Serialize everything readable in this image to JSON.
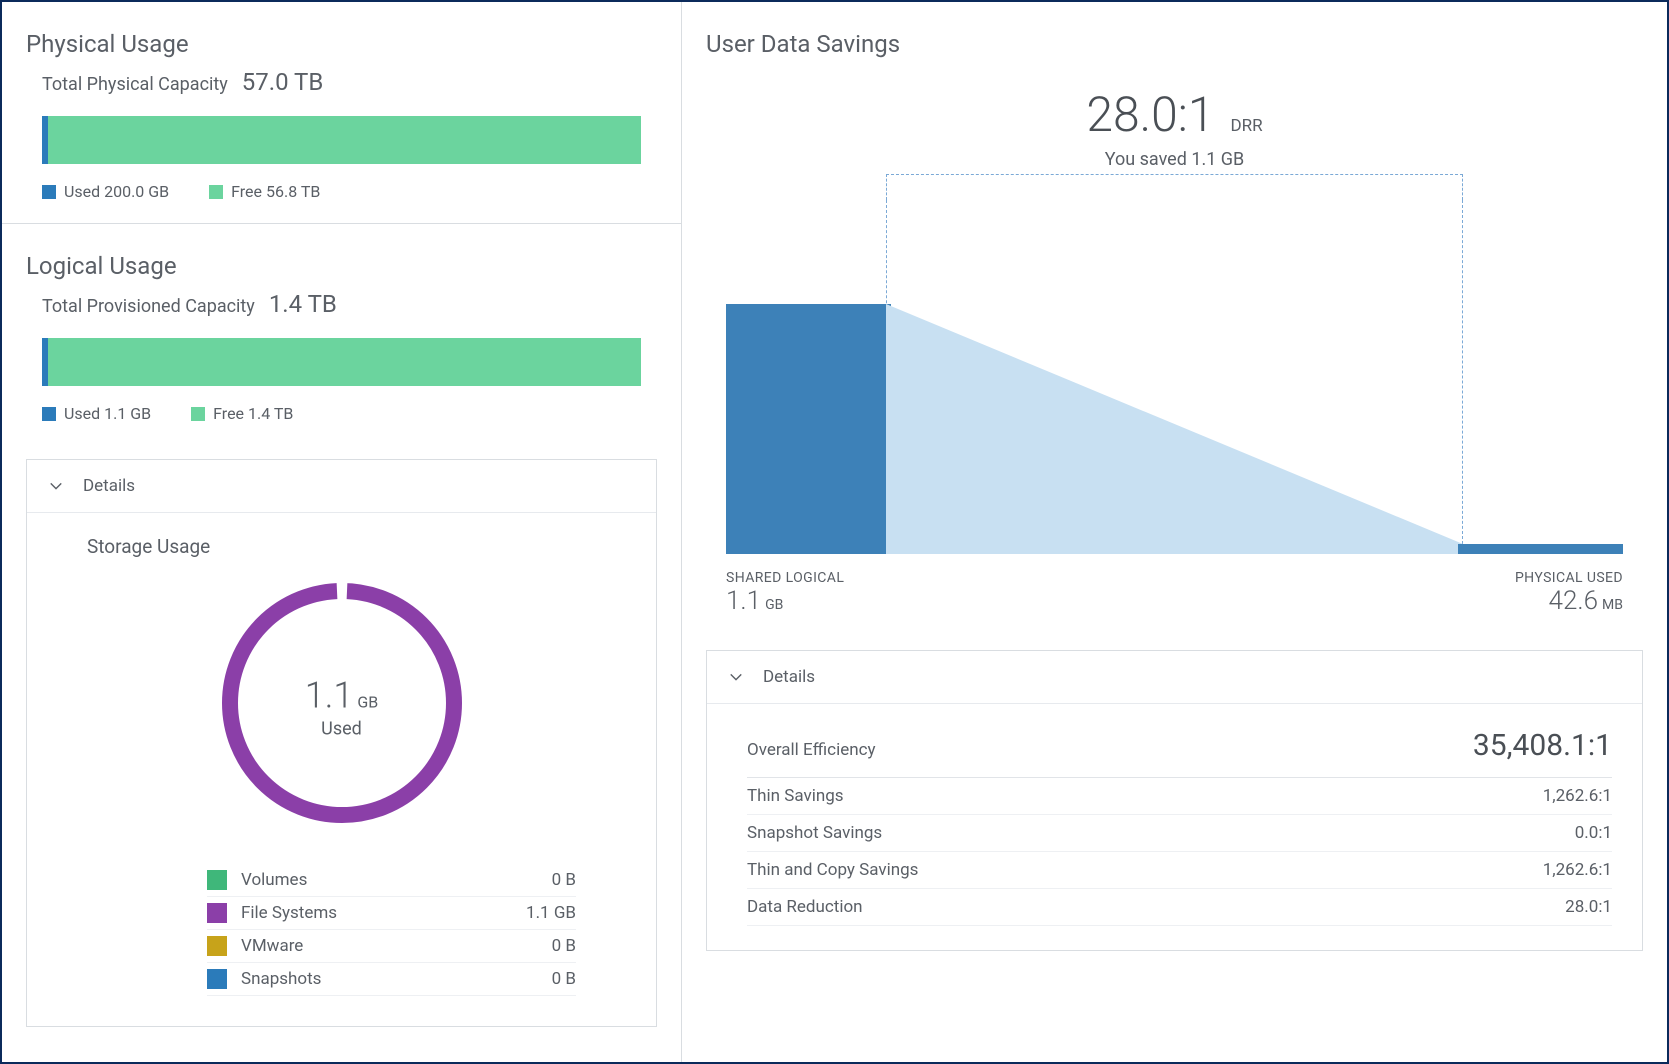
{
  "physical": {
    "title": "Physical Usage",
    "cap_label": "Total Physical Capacity",
    "cap_value": "57.0 TB",
    "used_legend": "Used 200.0 GB",
    "free_legend": "Free 56.8 TB",
    "used_ratio_pct": 0.4
  },
  "logical": {
    "title": "Logical Usage",
    "cap_label": "Total Provisioned Capacity",
    "cap_value": "1.4 TB",
    "used_legend": "Used 1.1 GB",
    "free_legend": "Free 1.4 TB",
    "used_ratio_pct": 0.5,
    "details_label": "Details",
    "storage_title": "Storage Usage",
    "donut_value": "1.1",
    "donut_unit": "GB",
    "donut_sub": "Used",
    "rows": [
      {
        "label": "Volumes",
        "value": "0 B",
        "swatch": "sw-vol"
      },
      {
        "label": "File Systems",
        "value": "1.1 GB",
        "swatch": "sw-fs"
      },
      {
        "label": "VMware",
        "value": "0 B",
        "swatch": "sw-vm"
      },
      {
        "label": "Snapshots",
        "value": "0 B",
        "swatch": "sw-sn"
      }
    ]
  },
  "savings": {
    "title": "User Data Savings",
    "drr_value": "28.0:1",
    "drr_unit": "DRR",
    "saved_line": "You saved 1.1 GB",
    "left_label": "SHARED LOGICAL",
    "left_value": "1.1",
    "left_unit": "GB",
    "right_label": "PHYSICAL USED",
    "right_value": "42.6",
    "right_unit": "MB",
    "details_label": "Details",
    "eff_rows": [
      {
        "label": "Overall Efficiency",
        "value": "35,408.1:1",
        "first": true
      },
      {
        "label": "Thin Savings",
        "value": "1,262.6:1"
      },
      {
        "label": "Snapshot Savings",
        "value": "0.0:1"
      },
      {
        "label": "Thin and Copy Savings",
        "value": "1,262.6:1"
      },
      {
        "label": "Data Reduction",
        "value": "28.0:1"
      }
    ]
  },
  "chart_data": [
    {
      "type": "bar",
      "title": "Physical Usage",
      "categories": [
        "Used",
        "Free"
      ],
      "values_tb": [
        0.2,
        56.8
      ],
      "total_tb": 57.0
    },
    {
      "type": "bar",
      "title": "Logical Usage",
      "categories": [
        "Used",
        "Free"
      ],
      "values_tb": [
        0.0011,
        1.4
      ],
      "total_tb": 1.4
    },
    {
      "type": "pie",
      "title": "Storage Usage",
      "categories": [
        "Volumes",
        "File Systems",
        "VMware",
        "Snapshots"
      ],
      "values_gb": [
        0,
        1.1,
        0,
        0
      ],
      "center_label": "1.1 GB Used"
    },
    {
      "type": "bar",
      "title": "User Data Savings",
      "categories": [
        "Shared Logical",
        "Physical Used"
      ],
      "values_mb": [
        1126.4,
        42.6
      ],
      "drr": "28.0:1"
    }
  ]
}
